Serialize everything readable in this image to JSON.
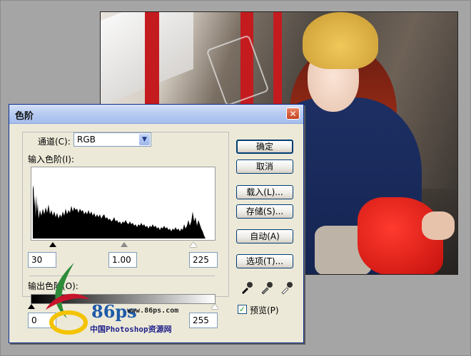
{
  "dialog": {
    "title": "色阶",
    "close_glyph": "✕",
    "channel_label": "通道(C):",
    "channel_value": "RGB",
    "input_levels_label": "输入色阶(I):",
    "input_black": "30",
    "input_gamma": "1.00",
    "input_white": "225",
    "output_levels_label": "输出色阶(O):",
    "output_black": "0",
    "output_white": "255",
    "buttons": {
      "ok": "确定",
      "cancel": "取消",
      "load": "载入(L)...",
      "save": "存储(S)...",
      "auto": "自动(A)",
      "options": "选项(T)..."
    },
    "preview_label": "预览(P)",
    "preview_checked": true
  },
  "watermark": {
    "logo_text": "86ps",
    "url": "www.86ps.com",
    "site_name": "中国Photoshop资源网"
  }
}
